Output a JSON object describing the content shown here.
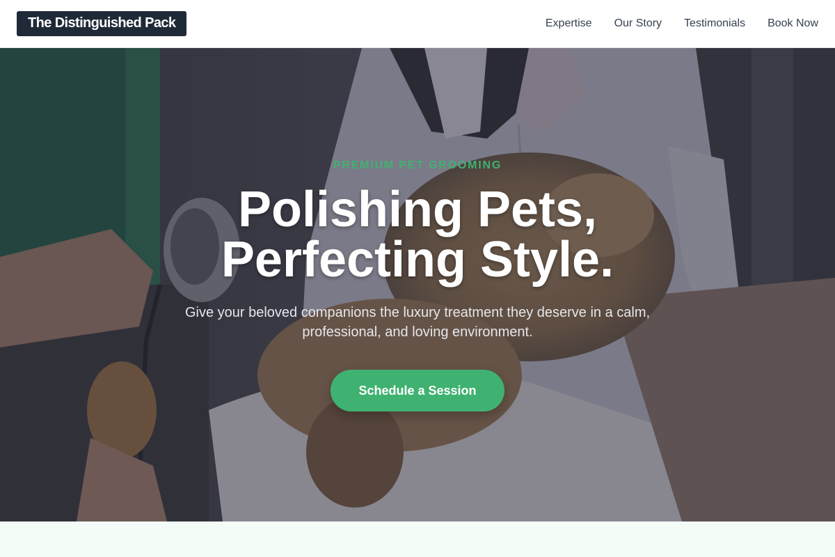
{
  "header": {
    "logo": "The Distinguished Pack",
    "nav": [
      "Expertise",
      "Our Story",
      "Testimonials",
      "Book Now"
    ]
  },
  "hero": {
    "eyebrow": "PREMIUM PET GROOMING",
    "headline_line1": "Polishing Pets,",
    "headline_line2": "Perfecting Style.",
    "subtext_line1": "Give your beloved companions the luxury treatment they deserve in a calm,",
    "subtext_line2": "professional, and loving environment.",
    "cta_label": "Schedule a Session"
  },
  "colors": {
    "accent": "#3fb271",
    "logo_background": "#1f2937",
    "nav_text": "#374151",
    "next_section_background": "#f3fcf7"
  }
}
